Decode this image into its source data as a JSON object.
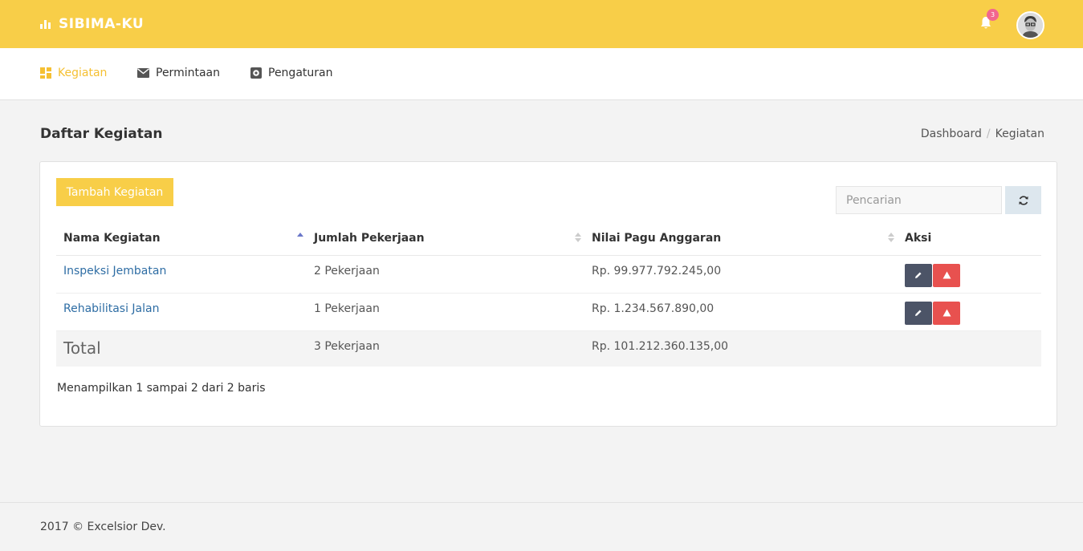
{
  "app": {
    "brand": "SIBIMA-KU",
    "notification_count": "3"
  },
  "nav": [
    {
      "label": "Kegiatan",
      "active": true
    },
    {
      "label": "Permintaan",
      "active": false
    },
    {
      "label": "Pengaturan",
      "active": false
    }
  ],
  "page": {
    "title": "Daftar Kegiatan"
  },
  "breadcrumb": {
    "home": "Dashboard",
    "separator": "/",
    "current": "Kegiatan"
  },
  "toolbar": {
    "add_label": "Tambah Kegiatan",
    "search_placeholder": "Pencarian"
  },
  "table": {
    "headers": [
      "Nama Kegiatan",
      "Jumlah Pekerjaan",
      "Nilai Pagu Anggaran",
      "Aksi"
    ],
    "rows": [
      {
        "name": "Inspeksi Jembatan",
        "jobs": "2 Pekerjaan",
        "budget": "Rp. 99.977.792.245,00"
      },
      {
        "name": "Rehabilitasi Jalan",
        "jobs": "1 Pekerjaan",
        "budget": "Rp. 1.234.567.890,00"
      }
    ],
    "total": {
      "label": "Total",
      "jobs": "3 Pekerjaan",
      "budget": "Rp. 101.212.360.135,00"
    }
  },
  "pagination_info": "Menampilkan 1 sampai 2 dari 2 baris",
  "footer": "2017 © Excelsior Dev.",
  "colors": {
    "brand": "#f8ce48",
    "edit": "#4c5467",
    "delete": "#e8514f",
    "link": "#2e6da4"
  }
}
